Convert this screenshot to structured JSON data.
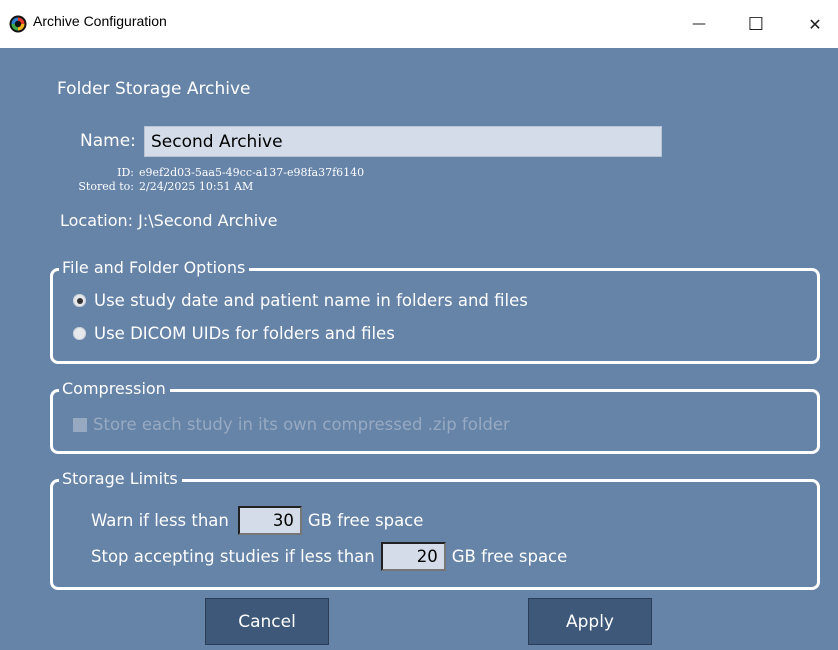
{
  "window": {
    "title": "Archive Configuration",
    "minimize_glyph": "—",
    "maximize_glyph": "☐",
    "close_glyph": "✕",
    "app_icon": "app-logo-icon"
  },
  "archive": {
    "heading": "Folder Storage Archive",
    "name_label": "Name:",
    "name_value": "Second Archive",
    "id_label": "ID:",
    "id_value": "e9ef2d03-5aa5-49cc-a137-e98fa37f6140",
    "stored_label": "Stored to:",
    "stored_value": "2/24/2025 10:51 AM",
    "location_label": "Location:",
    "location_value": "J:\\Second Archive"
  },
  "file_options": {
    "title": "File and Folder Options",
    "options": [
      {
        "label": "Use study date and patient name in folders and files",
        "checked": true
      },
      {
        "label": "Use DICOM UIDs for folders and files",
        "checked": false
      }
    ]
  },
  "compression": {
    "title": "Compression",
    "checkbox_label": "Store each study in its own compressed .zip folder",
    "checked": false,
    "enabled": false
  },
  "storage_limits": {
    "title": "Storage Limits",
    "warn_prefix": "Warn if less than",
    "warn_value": "30",
    "warn_suffix": "GB free space",
    "stop_prefix": "Stop accepting studies if less than",
    "stop_value": "20",
    "stop_suffix": "GB free space"
  },
  "buttons": {
    "cancel": "Cancel",
    "apply": "Apply"
  },
  "colors": {
    "background": "#6683a8",
    "button": "#3d5878",
    "input": "#d3dce8"
  }
}
